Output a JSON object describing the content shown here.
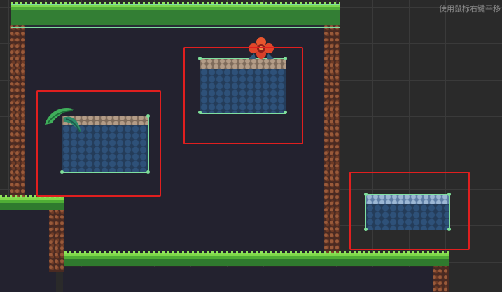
{
  "hint_text": "使用鼠标右键平移",
  "colors": {
    "selection": "#e01f1f",
    "collider": "#7fe0a0",
    "cave_background": "#23222f",
    "grass": "#4fae35"
  },
  "icons": {
    "flower": "rafflesia-flower-icon",
    "leaf": "fern-leaf-icon"
  }
}
